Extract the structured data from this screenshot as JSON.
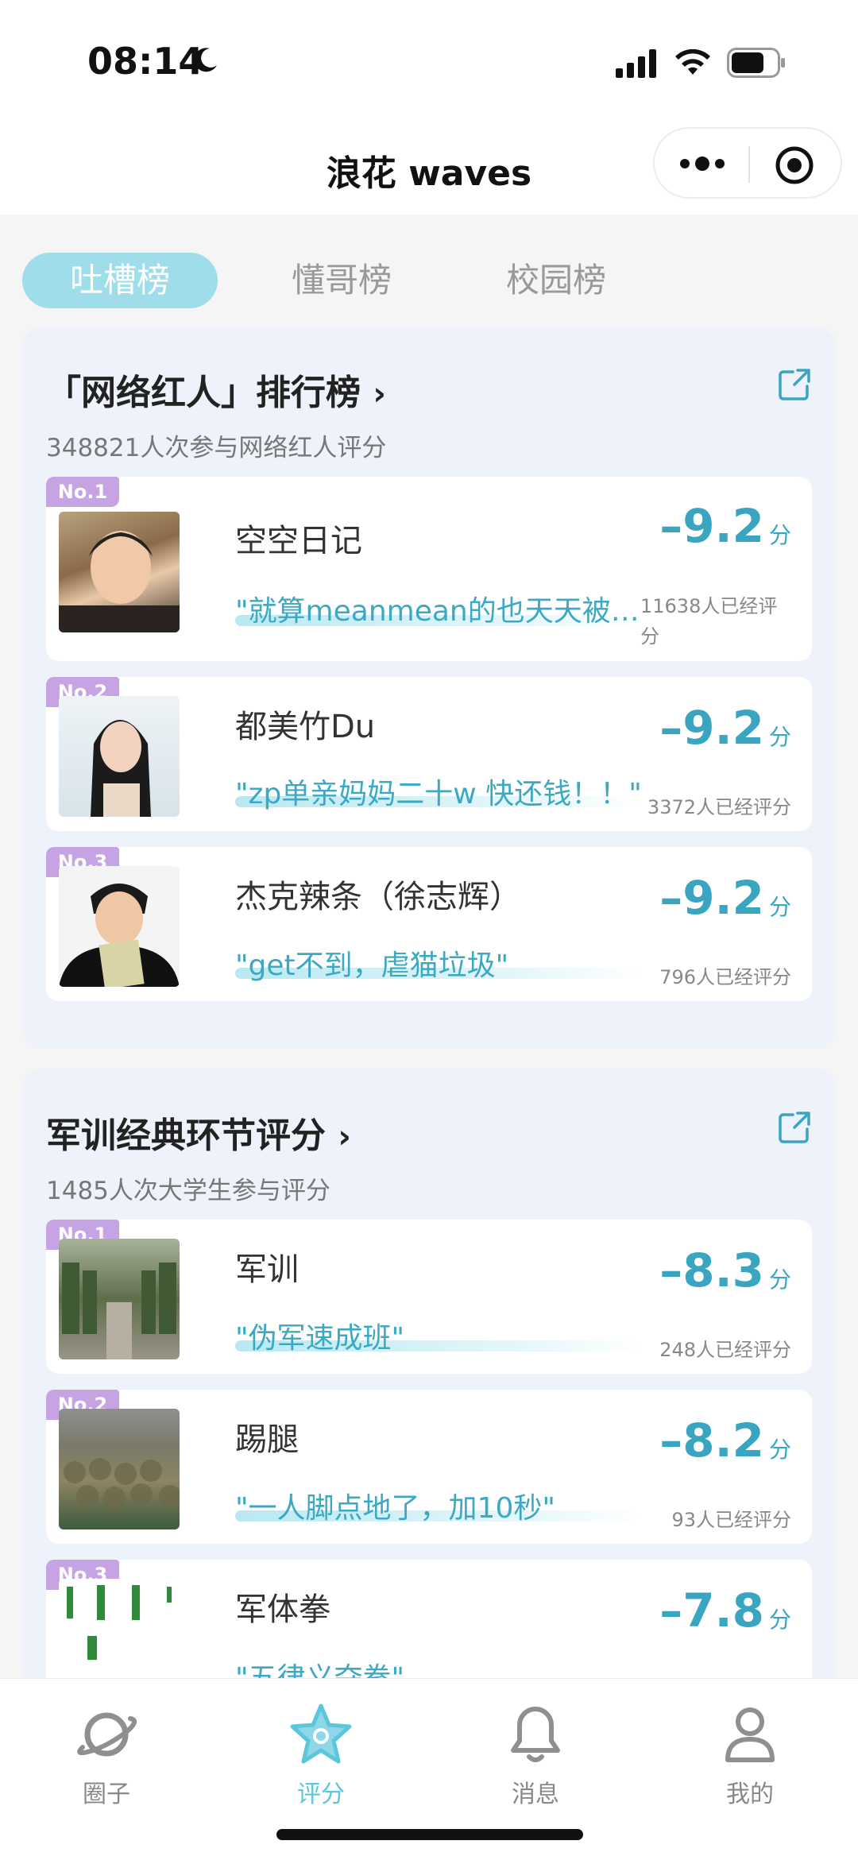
{
  "status_bar": {
    "time": "08:14"
  },
  "header": {
    "title": "浪花 waves"
  },
  "tabs": [
    {
      "label": "吐槽榜",
      "active": true
    },
    {
      "label": "懂哥榜",
      "active": false
    },
    {
      "label": "校园榜",
      "active": false
    }
  ],
  "sections": [
    {
      "title": "「网络红人」排行榜",
      "subtitle": "348821人次参与网络红人评分",
      "items": [
        {
          "rank": "No.1",
          "name": "空空日记",
          "quote": "\"就算meanmean的也天天被叫…",
          "score": "–9.2",
          "unit": "分",
          "count": "11638人已经评分"
        },
        {
          "rank": "No.2",
          "name": "都美竹Du",
          "quote": "\"zp单亲妈妈二十w 快还钱！！\"",
          "score": "–9.2",
          "unit": "分",
          "count": "3372人已经评分"
        },
        {
          "rank": "No.3",
          "name": "杰克辣条（徐志辉）",
          "quote": "\"get不到，虐猫垃圾\"",
          "score": "–9.2",
          "unit": "分",
          "count": "796人已经评分"
        }
      ]
    },
    {
      "title": "军训经典环节评分",
      "subtitle": "1485人次大学生参与评分",
      "items": [
        {
          "rank": "No.1",
          "name": "军训",
          "quote": "\"伪军速成班\"",
          "score": "–8.3",
          "unit": "分",
          "count": "248人已经评分"
        },
        {
          "rank": "No.2",
          "name": "踢腿",
          "quote": "\"一人脚点地了，加10秒\"",
          "score": "–8.2",
          "unit": "分",
          "count": "93人已经评分"
        },
        {
          "rank": "No.3",
          "name": "军体拳",
          "quote": "\"五律义夺拳\"",
          "score": "–7.8",
          "unit": "分",
          "count": ""
        }
      ]
    }
  ],
  "bottom_nav": [
    {
      "label": "圈子",
      "icon": "planet-icon",
      "active": false
    },
    {
      "label": "评分",
      "icon": "star-icon",
      "active": true
    },
    {
      "label": "消息",
      "icon": "bell-icon",
      "active": false
    },
    {
      "label": "我的",
      "icon": "person-icon",
      "active": false
    }
  ],
  "colors": {
    "accent": "#3aa5c0",
    "tab_active": "#9edde9",
    "rank_badge": "#c6a3e2",
    "section_bg": "#eef2fa"
  }
}
